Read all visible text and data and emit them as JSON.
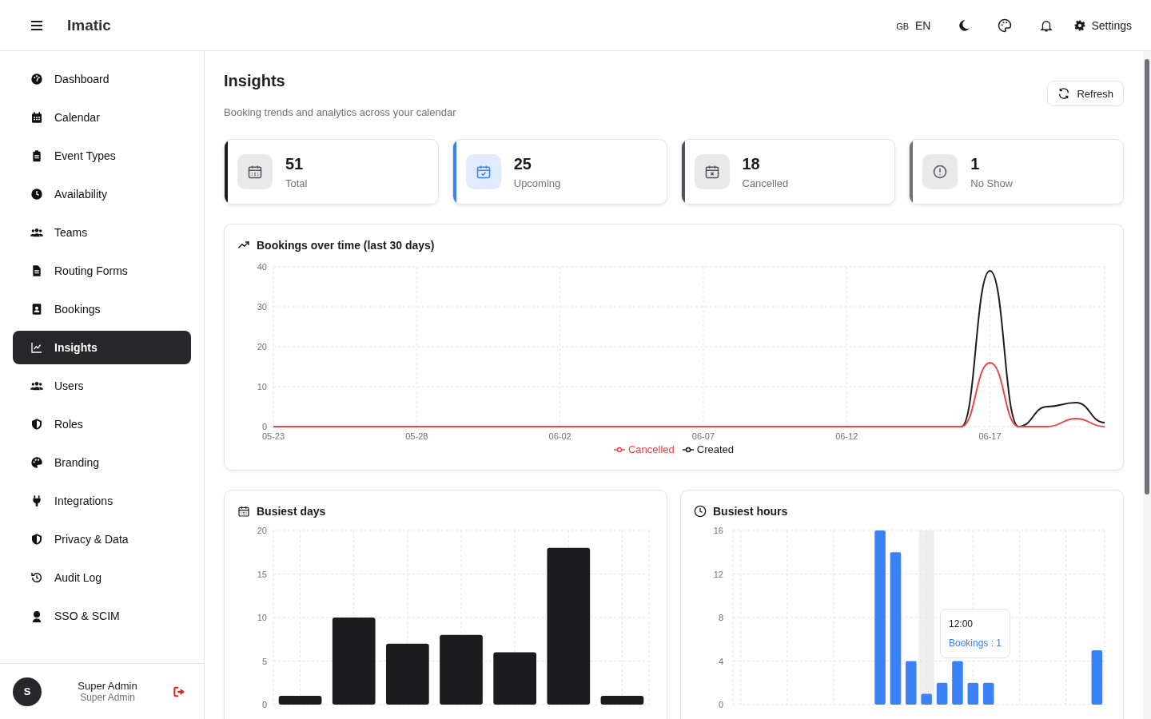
{
  "app": {
    "title": "Imatic"
  },
  "header": {
    "language_code": "GB",
    "language": "EN",
    "settings": "Settings"
  },
  "sidebar": {
    "items": [
      {
        "label": "Dashboard",
        "selected": false
      },
      {
        "label": "Calendar",
        "selected": false
      },
      {
        "label": "Event Types",
        "selected": false
      },
      {
        "label": "Availability",
        "selected": false
      },
      {
        "label": "Teams",
        "selected": false
      },
      {
        "label": "Routing Forms",
        "selected": false
      },
      {
        "label": "Bookings",
        "selected": false
      },
      {
        "label": "Insights",
        "selected": true
      },
      {
        "label": "Users",
        "selected": false
      },
      {
        "label": "Roles",
        "selected": false
      },
      {
        "label": "Branding",
        "selected": false
      },
      {
        "label": "Integrations",
        "selected": false
      },
      {
        "label": "Privacy & Data",
        "selected": false
      },
      {
        "label": "Audit Log",
        "selected": false
      },
      {
        "label": "SSO & SCIM",
        "selected": false
      }
    ],
    "user": {
      "initial": "S",
      "name": "Super Admin",
      "role": "Super Admin"
    }
  },
  "page": {
    "title": "Insights",
    "subtitle": "Booking trends and analytics across your calendar",
    "refresh": "Refresh"
  },
  "stats": [
    {
      "kind": "calendar",
      "value": "51",
      "label": "Total",
      "color": "#1c1c1e"
    },
    {
      "kind": "calendar-check",
      "value": "25",
      "label": "Upcoming",
      "color": "#3b82f6"
    },
    {
      "kind": "calendar-x",
      "value": "18",
      "label": "Cancelled",
      "color": "#52525b"
    },
    {
      "kind": "alert",
      "value": "1",
      "label": "No Show",
      "color": "#71717a"
    }
  ],
  "bookings_chart": {
    "title": "Bookings over time (last 30 days)",
    "chart_data": {
      "type": "line",
      "grid": true,
      "categories": [
        "05-23",
        null,
        null,
        null,
        null,
        "05-28",
        null,
        null,
        null,
        null,
        "06-02",
        null,
        null,
        null,
        null,
        "06-07",
        null,
        null,
        null,
        null,
        "06-12",
        null,
        null,
        null,
        null,
        "06-17",
        null,
        null,
        null,
        null
      ],
      "ylim": [
        0,
        40
      ],
      "yticks": [
        0,
        10,
        20,
        30,
        40
      ],
      "series": [
        {
          "name": "Cancelled",
          "color": "#ef4444",
          "values": [
            0,
            0,
            0,
            0,
            0,
            0,
            0,
            0,
            0,
            0,
            0,
            0,
            0,
            0,
            0,
            0,
            0,
            0,
            0,
            0,
            0,
            0,
            0,
            0,
            0,
            16,
            0,
            0,
            2,
            0
          ]
        },
        {
          "name": "Created",
          "color": "#1c1c1e",
          "values": [
            null,
            null,
            null,
            null,
            null,
            null,
            null,
            null,
            null,
            null,
            null,
            null,
            null,
            null,
            null,
            null,
            null,
            null,
            null,
            null,
            null,
            null,
            null,
            null,
            0,
            39,
            0,
            5,
            6,
            1
          ]
        }
      ]
    }
  },
  "busiest_days": {
    "title": "Busiest days",
    "chart_data": {
      "type": "bar",
      "grid": true,
      "ylim": [
        0,
        20
      ],
      "yticks": [
        0,
        5,
        10,
        15,
        20
      ],
      "series": [
        {
          "color": "#1c1c1e",
          "values": [
            1,
            10,
            7,
            8,
            6,
            18,
            1
          ]
        }
      ]
    }
  },
  "busiest_hours": {
    "title": "Busiest hours",
    "chart_data": {
      "type": "bar",
      "grid": true,
      "ylim": [
        0,
        16
      ],
      "yticks": [
        0,
        4,
        8,
        12,
        16
      ],
      "series": [
        {
          "color": "#3b82f6",
          "values": [
            0,
            0,
            0,
            0,
            0,
            0,
            0,
            0,
            0,
            16,
            14,
            4,
            1,
            2,
            4,
            2,
            2,
            0,
            0,
            0,
            0,
            0,
            0,
            5
          ]
        }
      ]
    },
    "tooltip": {
      "title": "12:00",
      "text": "Bookings : 1"
    }
  }
}
